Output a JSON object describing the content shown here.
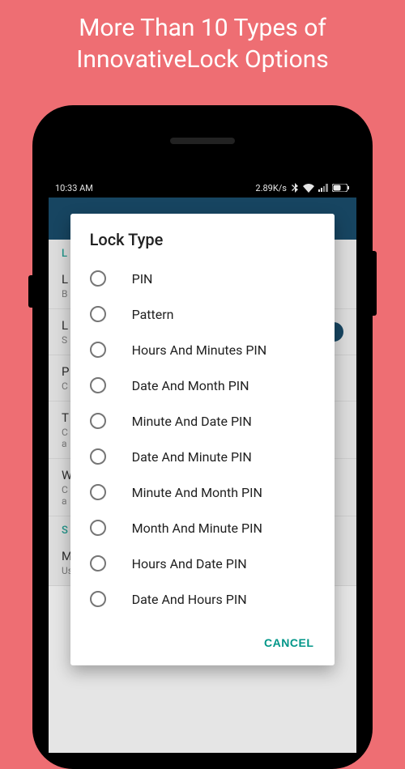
{
  "promo": {
    "line1": "More Than 10 Types of",
    "line2": "InnovativeLock Options"
  },
  "statusBar": {
    "time": "10:33 AM",
    "speed": "2.89K/s"
  },
  "background": {
    "sectionHeader1": "L",
    "items": [
      {
        "title": "L",
        "subtitle": "B"
      },
      {
        "title": "L",
        "subtitle": "S"
      },
      {
        "title": "P",
        "subtitle": "C"
      },
      {
        "title": "T",
        "subtitle1": "C",
        "subtitle2": "a"
      },
      {
        "title": "W",
        "subtitle1": "C",
        "subtitle2": "a"
      }
    ],
    "sectionHeader2": "S",
    "modifier": {
      "title": "M",
      "subtitle": "Using a modifier will change the special PIN type's"
    }
  },
  "dialog": {
    "title": "Lock Type",
    "options": [
      "PIN",
      "Pattern",
      "Hours And Minutes PIN",
      "Date And Month PIN",
      "Minute And Date PIN",
      "Date And Minute PIN",
      "Minute And Month PIN",
      "Month And Minute PIN",
      "Hours And Date PIN",
      "Date And Hours PIN"
    ],
    "cancelLabel": "CANCEL"
  }
}
